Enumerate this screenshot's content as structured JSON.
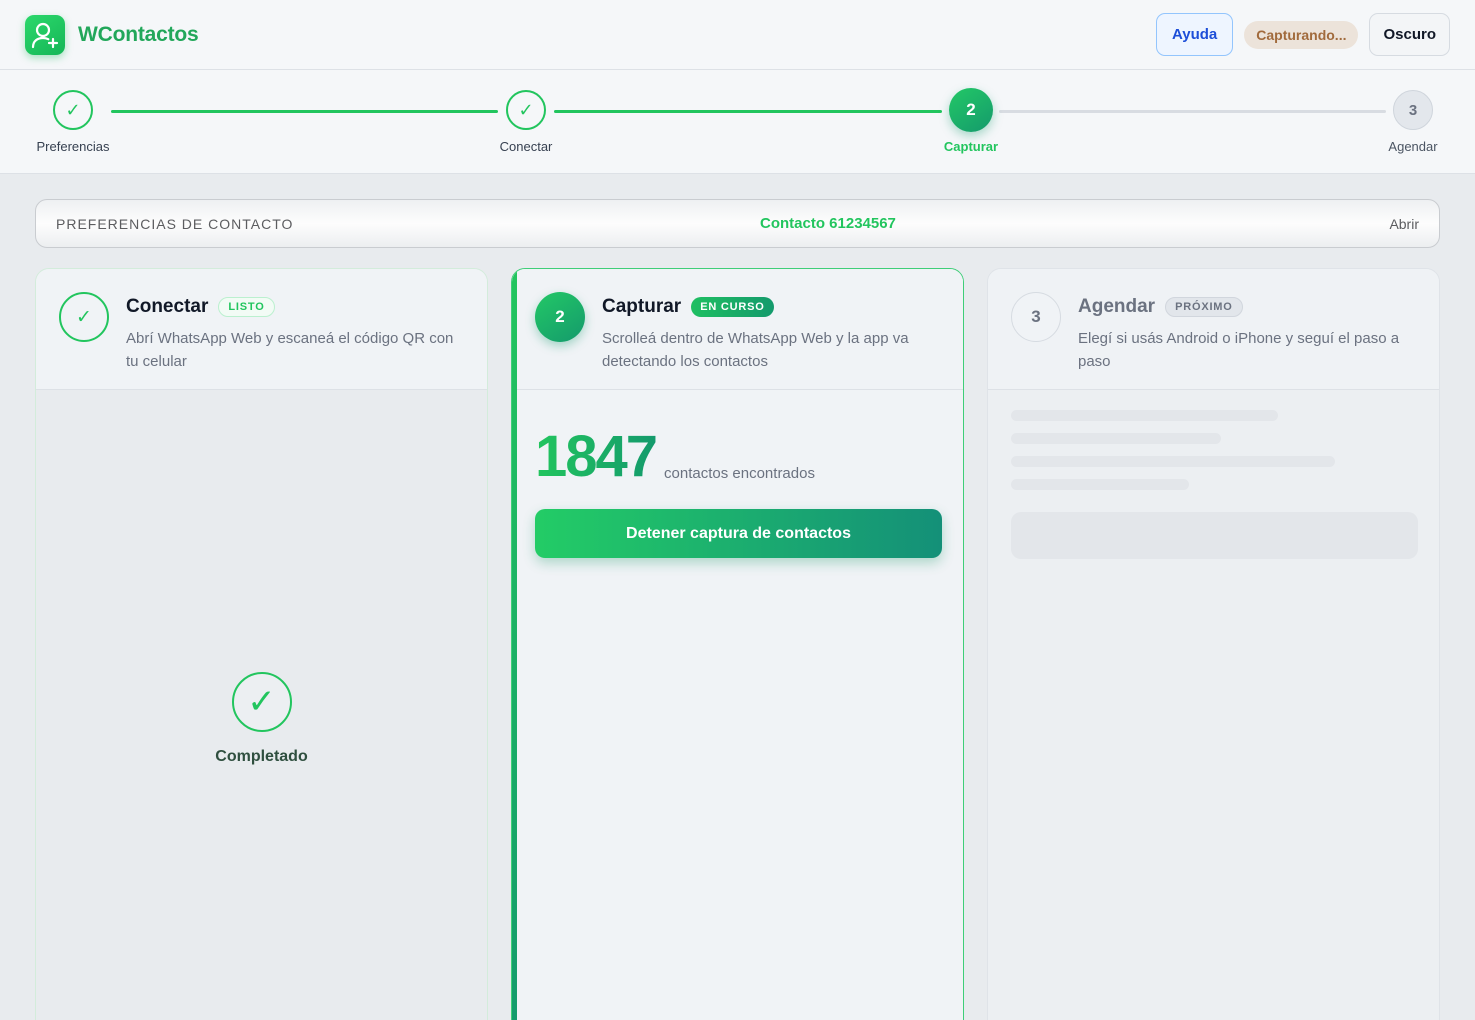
{
  "app": {
    "name": "WContactos"
  },
  "header": {
    "help_label": "Ayuda",
    "status_badge": "Capturando...",
    "theme_label": "Oscuro"
  },
  "stepper": {
    "steps": [
      {
        "label": "Preferencias",
        "state": "done",
        "symbol": "✓"
      },
      {
        "label": "Conectar",
        "state": "done",
        "symbol": "✓"
      },
      {
        "label": "Capturar",
        "state": "active",
        "symbol": "2"
      },
      {
        "label": "Agendar",
        "state": "pending",
        "symbol": "3"
      }
    ]
  },
  "preferences": {
    "title": "PREFERENCIAS DE CONTACTO",
    "contact": "Contacto 61234567",
    "open_label": "Abrir"
  },
  "cards": [
    {
      "symbol": "✓",
      "title": "Conectar",
      "badge": "LISTO",
      "description": "Abrí WhatsApp Web y escaneá el código QR con tu celular",
      "completed_label": "Completado",
      "completed_symbol": "✓"
    },
    {
      "symbol": "2",
      "title": "Capturar",
      "badge": "EN CURSO",
      "description": "Scrolleá dentro de WhatsApp Web y la app va detectando los contactos",
      "count": "1847",
      "count_label": "contactos encontrados",
      "stop_label": "Detener captura de contactos"
    },
    {
      "symbol": "3",
      "title": "Agendar",
      "badge": "PRÓXIMO",
      "description": "Elegí si usás Android o iPhone y seguí el paso a paso"
    }
  ],
  "colors": {
    "accent": "#22c55e",
    "accent_dark": "#149a6c",
    "help": "#1d4ed8",
    "capturing": "#a16a3c"
  },
  "icons": {
    "logo": "user-plus-icon",
    "done": "check-icon"
  }
}
